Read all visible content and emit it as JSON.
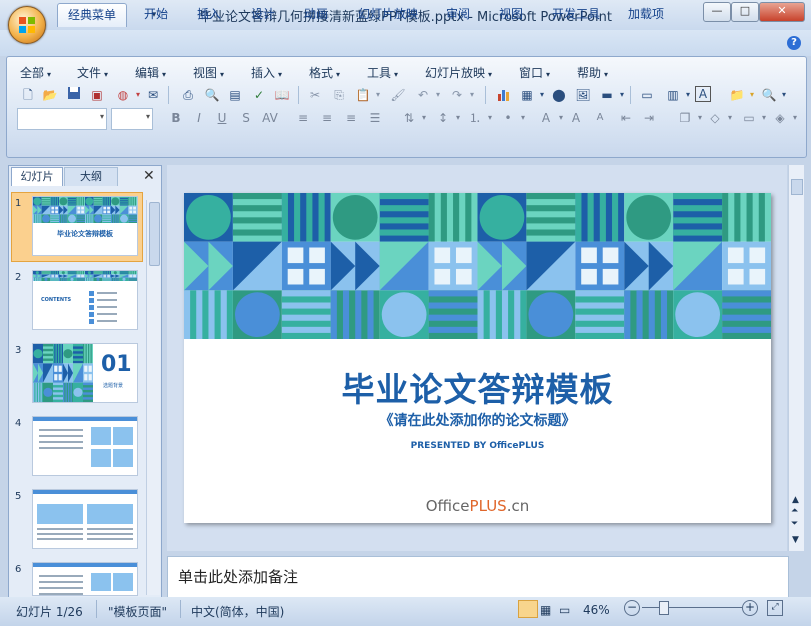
{
  "window": {
    "title": "毕业论文答辩几何拼接清新蓝绿PPT模板.pptx - Microsoft PowerPoint",
    "minimize": "—",
    "maximize": "□",
    "close": "✕"
  },
  "quick_access": [
    "save-icon",
    "undo-icon",
    "redo-icon",
    "customize-icon"
  ],
  "tabs": [
    "经典菜单",
    "开始",
    "插入",
    "设计",
    "动画",
    "幻灯片放映",
    "审阅",
    "视图",
    "开发工具",
    "加载项"
  ],
  "active_tab": "经典菜单",
  "menus": [
    "全部",
    "文件",
    "编辑",
    "视图",
    "插入",
    "格式",
    "工具",
    "幻灯片放映",
    "窗口",
    "帮助"
  ],
  "left_pane": {
    "tabs": [
      "幻灯片",
      "大纲"
    ],
    "close": "✕",
    "slides": [
      {
        "num": "1",
        "kind": "title",
        "title": "毕业论文答辩模板"
      },
      {
        "num": "2",
        "kind": "contents",
        "title": "CONTENTS"
      },
      {
        "num": "3",
        "kind": "section",
        "title": "01",
        "subtitle": "选题背景"
      },
      {
        "num": "4",
        "kind": "content"
      },
      {
        "num": "5",
        "kind": "content2"
      },
      {
        "num": "6",
        "kind": "content"
      }
    ]
  },
  "slide": {
    "title": "毕业论文答辩模板",
    "subtitle": "《请在此处添加你的论文标题》",
    "presented": "PRESENTED BY OfficePLUS",
    "brand_a": "Office",
    "brand_b": "PLUS",
    "brand_c": ".cn",
    "colors": {
      "dark": "#1d5fa8",
      "mid": "#4a8fd8",
      "teal": "#36b0a0",
      "mint": "#6bd4c0",
      "light": "#8bc2ee",
      "green": "#2f9a82"
    }
  },
  "notes_placeholder": "单击此处添加备注",
  "status": {
    "slide_counter": "幻灯片 1/26",
    "theme": "\"模板页面\"",
    "language": "中文(简体，中国)",
    "zoom": "46%"
  }
}
